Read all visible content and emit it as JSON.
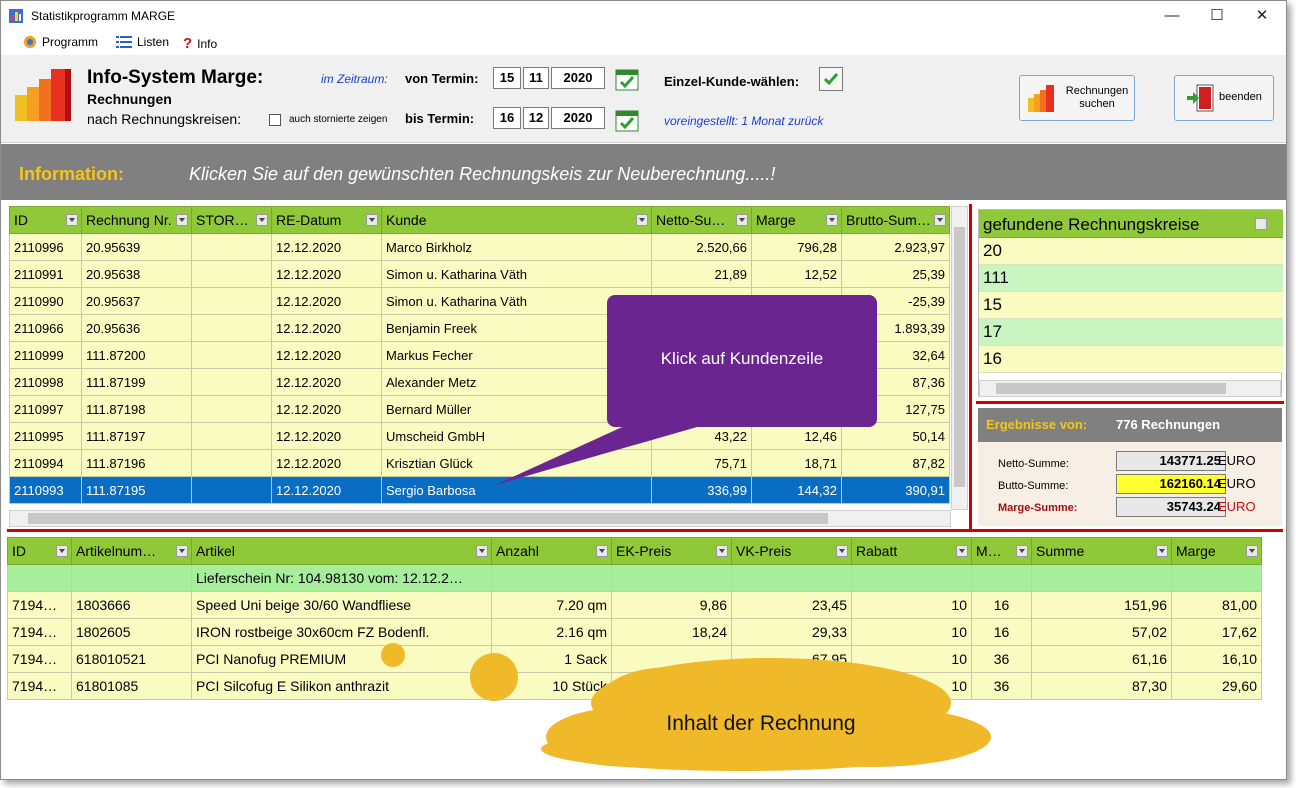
{
  "window": {
    "title": "Statistikprogramm MARGE"
  },
  "menu": [
    {
      "label": "Programm",
      "icon": "programm-icon"
    },
    {
      "label": "Listen",
      "icon": "list-icon"
    },
    {
      "label": "Info",
      "icon": "question-icon"
    }
  ],
  "header": {
    "title": "Info-System Marge:",
    "subtitle": "Rechnungen",
    "sub2": "nach Rechnungskreisen:",
    "storno_label": "auch stornierte zeigen",
    "zeitraum_label": "im Zeitraum:",
    "von_label": "von Termin:",
    "von_day": "15",
    "von_month": "11",
    "von_year": "2020",
    "bis_label": "bis Termin:",
    "bis_day": "16",
    "bis_month": "12",
    "bis_year": "2020",
    "einzel_label": "Einzel-Kunde-wählen:",
    "voreingestellt": "voreingestellt: 1 Monat zurück",
    "btn_suchen_line1": "Rechnungen",
    "btn_suchen_line2": "suchen",
    "btn_beenden": "beenden"
  },
  "info": {
    "label": "Information:",
    "text": "Klicken Sie auf den gewünschten Rechnungskeis zur Neuberechnung.....!"
  },
  "invoices": {
    "columns": [
      "ID",
      "Rechnung Nr.",
      "STOR…",
      "RE-Datum",
      "Kunde",
      "Netto-Su…",
      "Marge",
      "Brutto-Sum…"
    ],
    "rows": [
      [
        "2110996",
        "20.95639",
        "",
        "12.12.2020",
        "Marco Birkholz",
        "2.520,66",
        "796,28",
        "2.923,97"
      ],
      [
        "2110991",
        "20.95638",
        "",
        "12.12.2020",
        "Simon u. Katharina Väth",
        "21,89",
        "12,52",
        "25,39"
      ],
      [
        "2110990",
        "20.95637",
        "",
        "12.12.2020",
        "Simon u. Katharina Väth",
        "",
        "",
        "-25,39"
      ],
      [
        "2110966",
        "20.95636",
        "",
        "12.12.2020",
        "Benjamin Freek",
        "",
        "",
        "1.893,39"
      ],
      [
        "2110999",
        "111.87200",
        "",
        "12.12.2020",
        "Markus Fecher",
        "",
        "",
        "32,64"
      ],
      [
        "2110998",
        "111.87199",
        "",
        "12.12.2020",
        "Alexander Metz",
        "",
        "",
        "87,36"
      ],
      [
        "2110997",
        "111.87198",
        "",
        "12.12.2020",
        "Bernard Müller",
        "",
        "",
        "127,75"
      ],
      [
        "2110995",
        "111.87197",
        "",
        "12.12.2020",
        "Umscheid GmbH",
        "43,22",
        "12,46",
        "50,14"
      ],
      [
        "2110994",
        "111.87196",
        "",
        "12.12.2020",
        "Krisztian Glück",
        "75,71",
        "18,71",
        "87,82"
      ],
      [
        "2110993",
        "111.87195",
        "",
        "12.12.2020",
        "Sergio Barbosa",
        "336,99",
        "144,32",
        "390,91"
      ]
    ]
  },
  "kreise": {
    "header": "gefundene Rechnungskreise",
    "items": [
      "20",
      "111",
      "15",
      "17",
      "16"
    ]
  },
  "ergebnisse": {
    "label": "Ergebnisse von:",
    "count": "776 Rechnungen",
    "netto_label": "Netto-Summe:",
    "netto_value": "143771.25",
    "brutto_label": "Butto-Summe:",
    "brutto_value": "162160.14",
    "marge_label": "Marge-Summe:",
    "marge_value": "35743.24",
    "currency": "EURO"
  },
  "items": {
    "columns": [
      "ID",
      "Artikelnum…",
      "Artikel",
      "Anzahl",
      "EK-Preis",
      "VK-Preis",
      "Rabatt",
      "M…",
      "Summe",
      "Marge"
    ],
    "lieferschein": "Lieferschein  Nr:  104.98130  vom:  12.12.2…",
    "rows": [
      [
        "7194…",
        "1803666",
        "Speed Uni beige 30/60 Wandfliese",
        "7.20 qm",
        "9,86",
        "23,45",
        "10",
        "16",
        "151,96",
        "81,00"
      ],
      [
        "7194…",
        "1802605",
        "IRON rostbeige 30x60cm FZ Bodenfl.",
        "2.16 qm",
        "18,24",
        "29,33",
        "10",
        "16",
        "57,02",
        "17,62"
      ],
      [
        "7194…",
        "618010521",
        "PCI Nanofug PREMIUM",
        "1 Sack",
        "",
        "67,95",
        "10",
        "36",
        "61,16",
        "16,10"
      ],
      [
        "7194…",
        "61801085",
        "PCI Silcofug E Silikon anthrazit",
        "10 Stück",
        "",
        "",
        "10",
        "36",
        "87,30",
        "29,60"
      ]
    ]
  },
  "callouts": {
    "purple": "Klick auf Kundenzeile",
    "cloud": "Inhalt der Rechnung"
  },
  "colors": {
    "accent_green": "#8fc93a",
    "row_yellow": "#fafbc0",
    "row_green": "#a6ee9c",
    "selected_blue": "#0a6dc4",
    "info_gray": "#808080",
    "callout_purple": "#6a2590",
    "cloud_yellow": "#f0b92a"
  }
}
